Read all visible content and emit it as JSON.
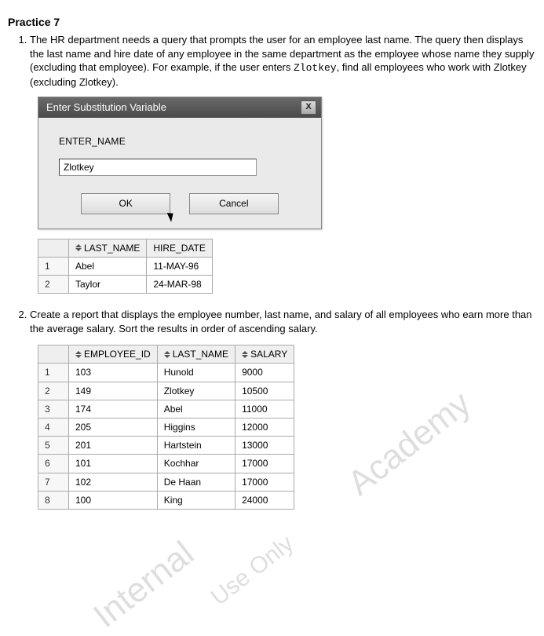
{
  "practice": {
    "title": "Practice 7"
  },
  "q1": {
    "text_a": "The HR department needs a query that prompts the user for an employee last name. The query then displays the last name and hire date of any employee in the same department as the employee whose name they supply (excluding that employee). For example, if the user enters ",
    "code": "Zlotkey",
    "text_b": ", find all employees who work with Zlotkey (excluding Zlotkey).",
    "dialog": {
      "title": "Enter Substitution Variable",
      "label": "ENTER_NAME",
      "value": "Zlotkey",
      "ok": "OK",
      "cancel": "Cancel"
    },
    "result": {
      "cols": {
        "c1": "LAST_NAME",
        "c2": "HIRE_DATE"
      },
      "rows": [
        {
          "n": "1",
          "last": "Abel",
          "hire": "11-MAY-96"
        },
        {
          "n": "2",
          "last": "Taylor",
          "hire": "24-MAR-98"
        }
      ]
    }
  },
  "q2": {
    "text": "Create a report that displays the employee number, last name, and salary of all employees who earn more than the average salary. Sort the results in order of ascending salary.",
    "result": {
      "cols": {
        "c1": "EMPLOYEE_ID",
        "c2": "LAST_NAME",
        "c3": "SALARY"
      },
      "rows": [
        {
          "n": "1",
          "id": "103",
          "last": "Hunold",
          "sal": "9000"
        },
        {
          "n": "2",
          "id": "149",
          "last": "Zlotkey",
          "sal": "10500"
        },
        {
          "n": "3",
          "id": "174",
          "last": "Abel",
          "sal": "11000"
        },
        {
          "n": "4",
          "id": "205",
          "last": "Higgins",
          "sal": "12000"
        },
        {
          "n": "5",
          "id": "201",
          "last": "Hartstein",
          "sal": "13000"
        },
        {
          "n": "6",
          "id": "101",
          "last": "Kochhar",
          "sal": "17000"
        },
        {
          "n": "7",
          "id": "102",
          "last": "De Haan",
          "sal": "17000"
        },
        {
          "n": "8",
          "id": "100",
          "last": "King",
          "sal": "24000"
        }
      ]
    }
  },
  "watermark": {
    "w1": "Academy",
    "w2": "Internal",
    "w3": "Use Only"
  }
}
